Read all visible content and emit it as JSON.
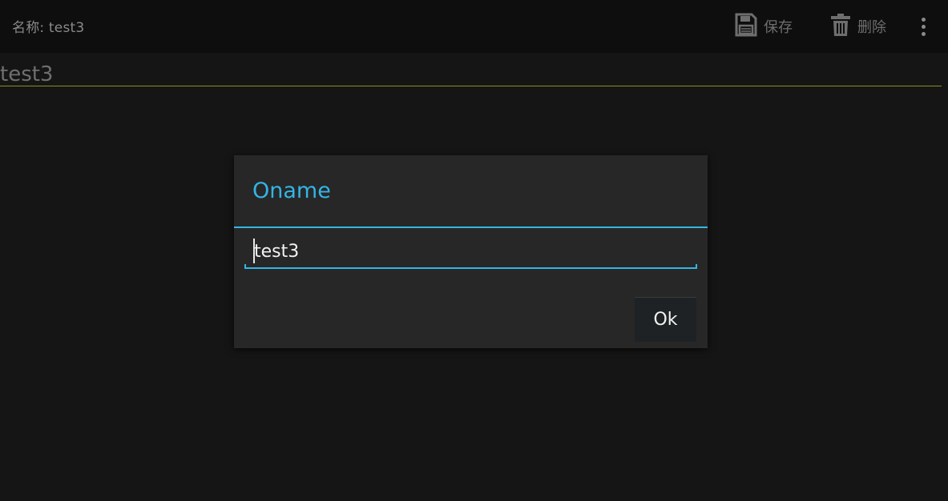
{
  "action_bar": {
    "title": "名称: test3",
    "save_label": "保存",
    "delete_label": "删除",
    "save_icon": "floppy-disk-icon",
    "delete_icon": "trash-icon",
    "overflow_icon": "more-vert-icon"
  },
  "name_field": {
    "value": "test3",
    "underline_color": "#8a8f1e"
  },
  "dialog": {
    "title": "Oname",
    "input_value": "test3",
    "ok_label": "Ok",
    "accent_color": "#33b5e5"
  }
}
